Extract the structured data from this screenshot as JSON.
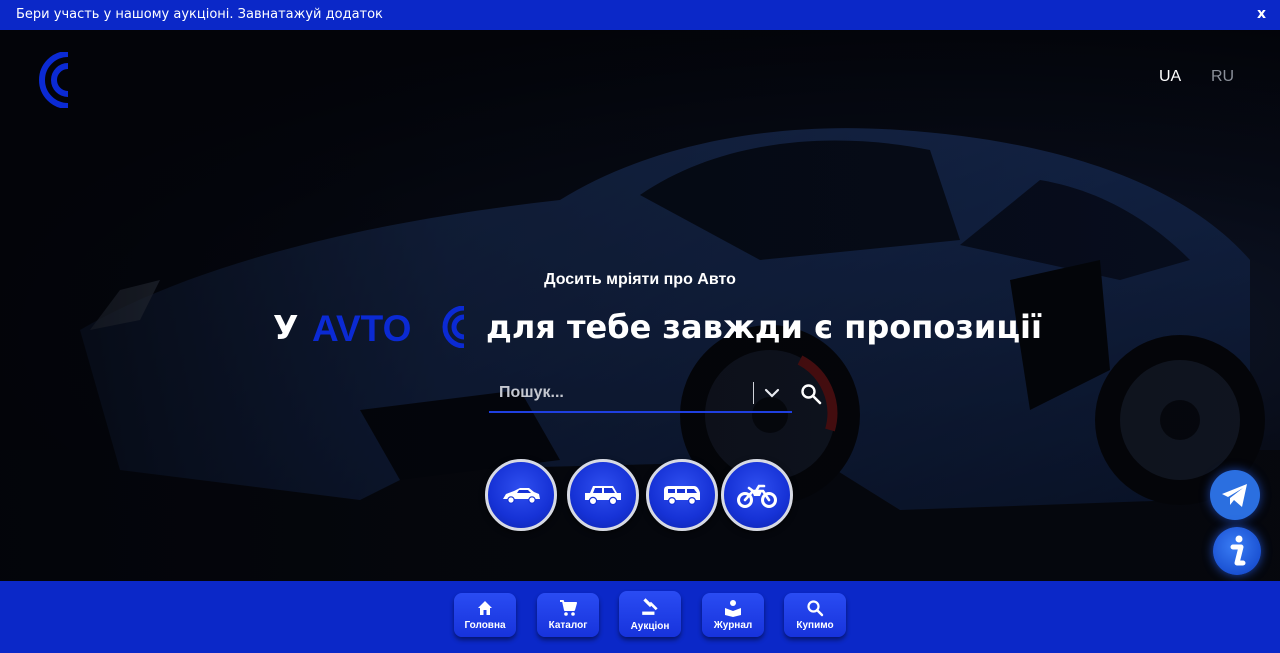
{
  "banner": {
    "text": "Бери участь у нашому аукціоні. Завнатажуй додаток",
    "close": "x"
  },
  "header": {
    "logo_icon": "brand-arc-icon",
    "languages": [
      {
        "code": "UA",
        "active": true
      },
      {
        "code": "RU",
        "active": false
      }
    ]
  },
  "hero": {
    "subtitle": "Досить мріяти про Авто",
    "headline_prefix": "У",
    "brand": "AVTO",
    "headline_suffix": "для тебе завжди є пропозиції",
    "background_icon": "sports-car-image"
  },
  "search": {
    "placeholder": "Пошук...",
    "value": "",
    "dropdown_icon": "chevron-down-icon",
    "button_icon": "search-icon"
  },
  "categories": [
    {
      "icon": "sedan-icon"
    },
    {
      "icon": "suv-icon"
    },
    {
      "icon": "van-icon"
    },
    {
      "icon": "motorcycle-icon"
    }
  ],
  "floating": {
    "telegram_icon": "telegram-icon",
    "info_icon": "info-icon"
  },
  "bottom_nav": {
    "items": [
      {
        "label": "Головна",
        "icon": "home-icon",
        "active": false
      },
      {
        "label": "Каталог",
        "icon": "cart-icon",
        "active": false
      },
      {
        "label": "Аукціон",
        "icon": "gavel-icon",
        "active": true
      },
      {
        "label": "Журнал",
        "icon": "journal-icon",
        "active": false
      },
      {
        "label": "Купимо",
        "icon": "search-icon",
        "active": false
      }
    ]
  },
  "colors": {
    "brand_blue": "#0b28c8",
    "button_blue": "#1733dc",
    "background": "#05060d"
  }
}
